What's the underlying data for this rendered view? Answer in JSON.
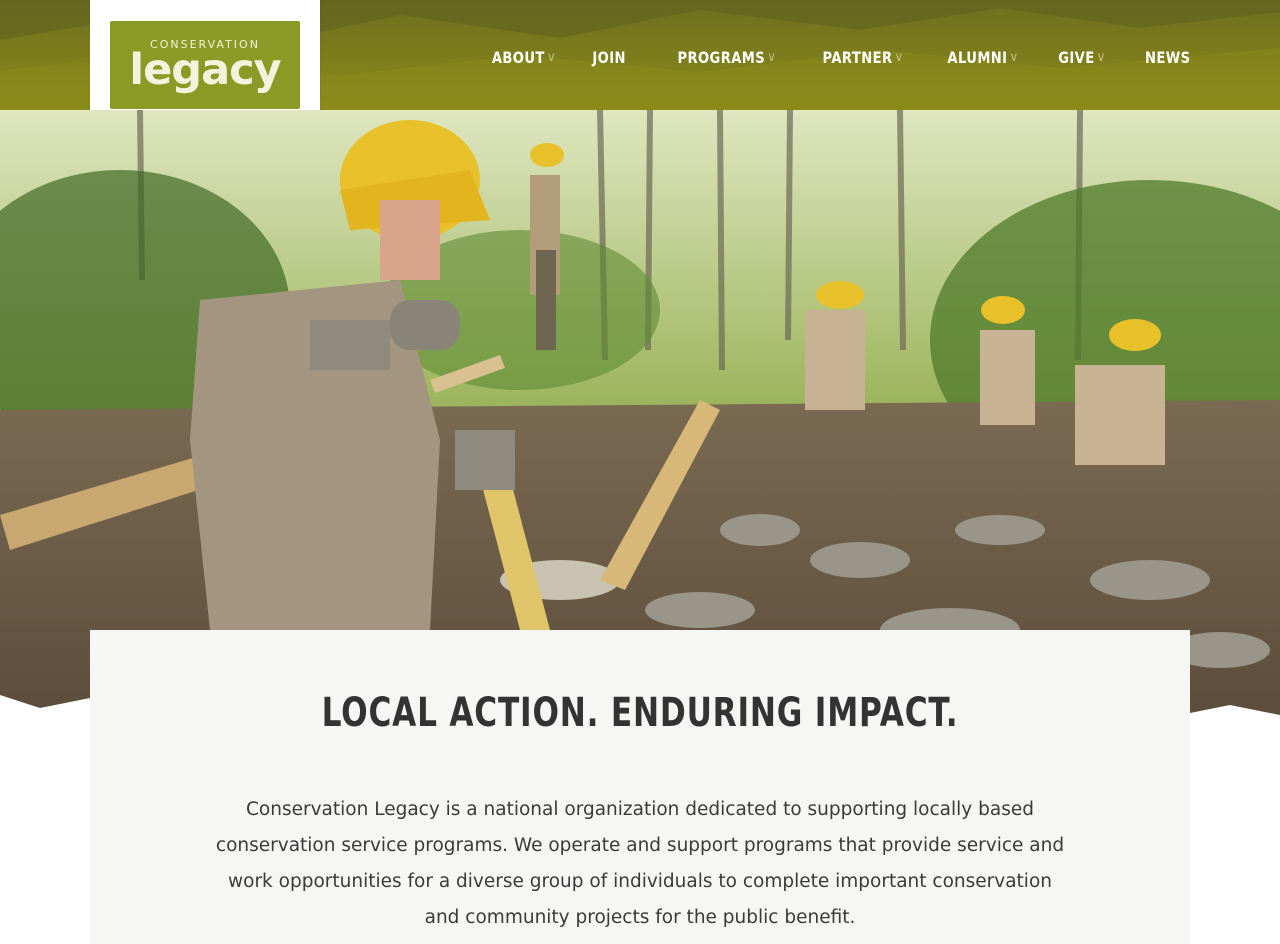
{
  "header": {
    "logo": {
      "top_text": "CONSERVATION",
      "main_text": "legacy"
    },
    "nav": [
      {
        "label": "ABOUT",
        "has_dropdown": true
      },
      {
        "label": "JOIN",
        "has_dropdown": false
      },
      {
        "label": "PROGRAMS",
        "has_dropdown": true
      },
      {
        "label": "PARTNER",
        "has_dropdown": true
      },
      {
        "label": "ALUMNI",
        "has_dropdown": true
      },
      {
        "label": "GIVE",
        "has_dropdown": true
      },
      {
        "label": "NEWS",
        "has_dropdown": false
      }
    ],
    "chevron_glyph": "v"
  },
  "hero": {
    "image": "trail-crew-photo"
  },
  "main": {
    "heading": "LOCAL ACTION. ENDURING IMPACT.",
    "body": "Conservation Legacy is a national organization dedicated to supporting locally based conservation service programs. We operate and support programs that provide service and work opportunities for a diverse group of individuals to complete important conservation and community projects for the public benefit."
  },
  "colors": {
    "header_olive": "#7b7b1c",
    "logo_green": "#8a9a25",
    "card_bg": "#f6f6f5",
    "heading_text": "#333333"
  }
}
